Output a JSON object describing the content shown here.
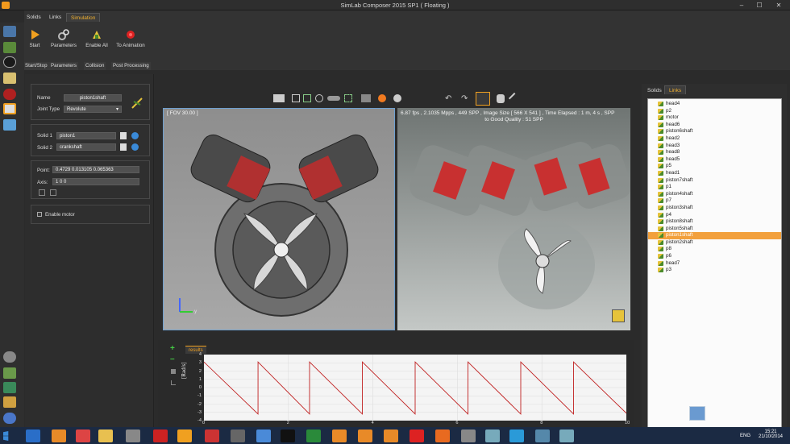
{
  "window": {
    "title": "SimLab Composer 2015 SP1 ( Floating )",
    "minimize": "–",
    "restore": "☐",
    "close": "✕"
  },
  "ribbon": {
    "tabs": [
      "Solids",
      "Links",
      "Simulation"
    ],
    "active_tab": "Simulation",
    "buttons": [
      {
        "label": "Start",
        "icon": "play-icon",
        "color": "#f0a020"
      },
      {
        "label": "Parameters",
        "icon": "gears-icon",
        "color": "#bbbbbb"
      },
      {
        "label": "Enable All",
        "icon": "enable-all-icon",
        "color": "#e6c33a"
      },
      {
        "label": "To Animation",
        "icon": "record-icon",
        "color": "#d22"
      }
    ],
    "groups": [
      "Start/Stop",
      "Parameters",
      "Collision",
      "Post Processing"
    ]
  },
  "link_panel": {
    "name_label": "Name",
    "name_value": "piston1shaft",
    "joint_type_label": "Joint Type",
    "joint_type_value": "Revolute",
    "solid1_label": "Solid 1",
    "solid1_value": "piston1",
    "solid2_label": "Solid 2",
    "solid2_value": "crankshaft",
    "point_label": "Point:",
    "point_value": "0.4729 0.013105 0.065363",
    "axis_label": "Axis:",
    "axis_value": "1 0 0",
    "enable_motor_label": "Enable motor"
  },
  "viewport_left": {
    "fov": "[ FOV 30.00 ]",
    "axis_y": "y"
  },
  "viewport_right": {
    "stats_line1": "6.87 fps ,  2.1035 Mpps ,   449 SPP   ,  Image Size [ 566 X 541 ] , Time Elapsed : 1 m, 4 s , SPP",
    "stats_line2": "to Good Quality : 51 SPP"
  },
  "results": {
    "tab_label": "results",
    "ylabel": "[Rad/s]",
    "add_icon": "+",
    "remove_icon": "–"
  },
  "chart_data": {
    "type": "line",
    "title": "",
    "xlabel": "",
    "ylabel": "[Rad/s]",
    "xlim": [
      0,
      10
    ],
    "ylim": [
      -4,
      4
    ],
    "xticks": [
      0,
      2,
      4,
      6,
      8,
      10
    ],
    "yticks": [
      4,
      3,
      2,
      1,
      0,
      -1,
      -2,
      -3,
      -4
    ],
    "series": [
      {
        "color": "#c02020",
        "x": [
          0,
          1.28,
          1.28,
          2.5,
          2.5,
          3.75,
          3.75,
          5.0,
          5.0,
          6.25,
          6.25,
          7.5,
          7.5,
          8.75,
          8.75,
          10
        ],
        "values": [
          3.1,
          -3.2,
          3.1,
          -3.2,
          3.1,
          -3.2,
          3.1,
          -3.2,
          3.1,
          -3.2,
          3.1,
          -3.2,
          3.1,
          -3.2,
          3.1,
          -3.1
        ]
      }
    ]
  },
  "right_panel": {
    "tabs": [
      "Solids",
      "Links"
    ],
    "active_tab": "Links",
    "items": [
      "head4",
      "p2",
      "motor",
      "head6",
      "piston6shaft",
      "head2",
      "head3",
      "head8",
      "head5",
      "p5",
      "head1",
      "piston7shaft",
      "p1",
      "piston4shaft",
      "p7",
      "piston3shaft",
      "p4",
      "piston8shaft",
      "piston5shaft",
      "piston1shaft",
      "piston2shaft",
      "p8",
      "p6",
      "head7",
      "p3"
    ],
    "selected": "piston1shaft"
  },
  "taskbar": {
    "tray_lang": "ENG",
    "time": "15:21",
    "date": "21/10/2014"
  },
  "colors": {
    "accent": "#f0a020",
    "selection": "#f2a03c",
    "viewport_border": "#6fa0d0"
  }
}
